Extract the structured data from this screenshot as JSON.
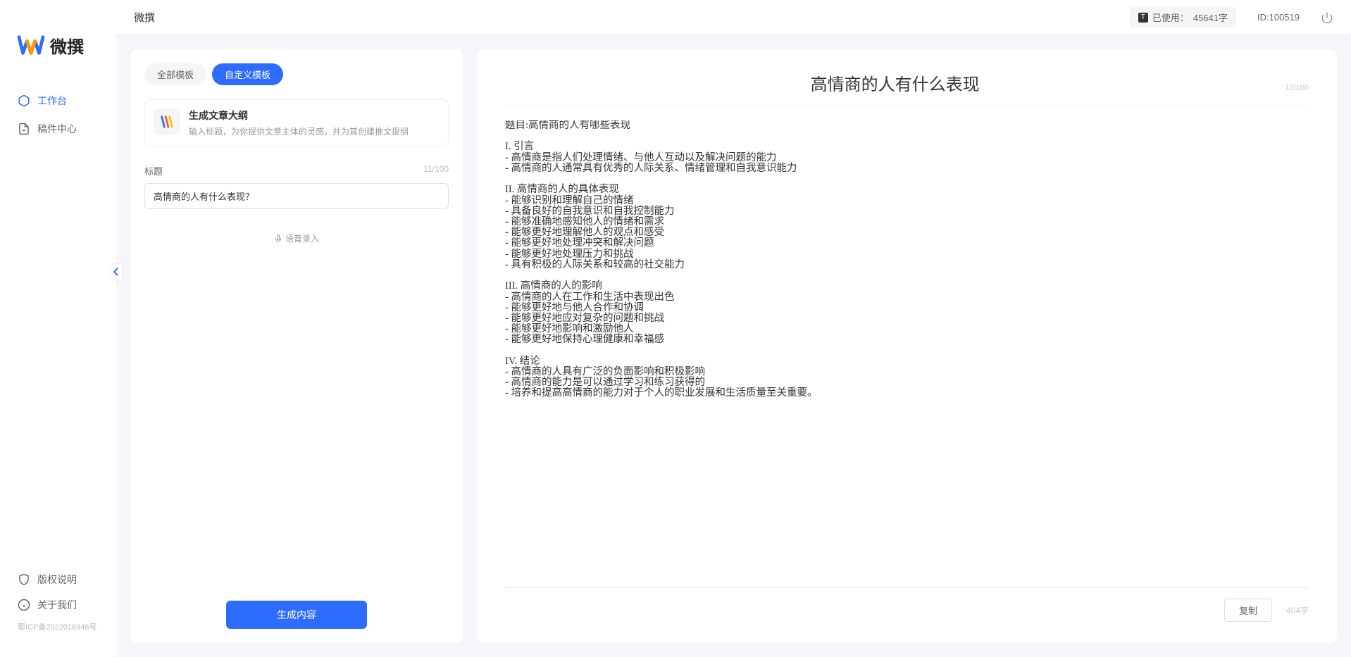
{
  "logo": {
    "text": "微撰"
  },
  "sidebar": {
    "items": [
      {
        "label": "工作台",
        "icon": "workbench"
      },
      {
        "label": "稿件中心",
        "icon": "drafts"
      }
    ],
    "bottom": [
      {
        "label": "版权说明",
        "icon": "copyright"
      },
      {
        "label": "关于我们",
        "icon": "about"
      }
    ],
    "icp": "鄂ICP备2022016946号"
  },
  "header": {
    "title": "微撰",
    "usage_label": "已使用：",
    "usage_value": "45641字",
    "user_id": "ID:100519"
  },
  "left_panel": {
    "tabs": [
      {
        "label": "全部模板"
      },
      {
        "label": "自定义模板"
      }
    ],
    "template": {
      "title": "生成文章大纲",
      "desc": "输入标题，为你提供文章主体的灵感，并为其创建推文提纲"
    },
    "form": {
      "title_label": "标题",
      "title_counter": "11/100",
      "title_value": "高情商的人有什么表现？",
      "voice_label": "语音录入"
    },
    "generate_btn": "生成内容"
  },
  "right_panel": {
    "title": "高情商的人有什么表现",
    "title_counter": "10/100",
    "content": "题目:高情商的人有哪些表现\n\nI. 引言\n- 高情商是指人们处理情绪、与他人互动以及解决问题的能力\n- 高情商的人通常具有优秀的人际关系、情绪管理和自我意识能力\n\nII. 高情商的人的具体表现\n- 能够识别和理解自己的情绪\n- 具备良好的自我意识和自我控制能力\n- 能够准确地感知他人的情绪和需求\n- 能够更好地理解他人的观点和感受\n- 能够更好地处理冲突和解决问题\n- 能够更好地处理压力和挑战\n- 具有积极的人际关系和较高的社交能力\n\nIII. 高情商的人的影响\n- 高情商的人在工作和生活中表现出色\n- 能够更好地与他人合作和协调\n- 能够更好地应对复杂的问题和挑战\n- 能够更好地影响和激励他人\n- 能够更好地保持心理健康和幸福感\n\nIV. 结论\n- 高情商的人具有广泛的负面影响和积极影响\n- 高情商的能力是可以通过学习和练习获得的\n- 培养和提高高情商的能力对于个人的职业发展和生活质量至关重要。",
    "copy_btn": "复制",
    "word_count": "404字"
  }
}
